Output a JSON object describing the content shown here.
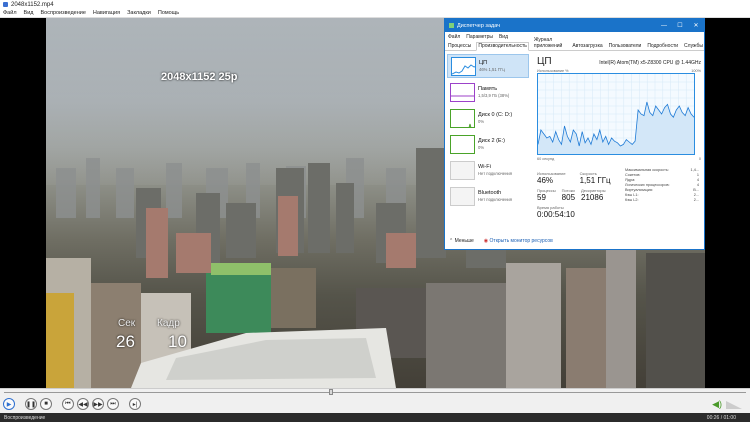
{
  "window": {
    "title": "2048x1152.mp4"
  },
  "menu": [
    "Файл",
    "Вид",
    "Воспроизведение",
    "Навигация",
    "Закладки",
    "Помощь"
  ],
  "osd": {
    "resolution": "2048x1152 25p",
    "sec_label": "Сек",
    "sec_value": "26",
    "frame_label": "Кадр",
    "frame_value": "10"
  },
  "seek": {
    "progress_fraction": 0.44
  },
  "controls": [
    "play-icon",
    "pause-icon",
    "stop-icon",
    "prev-icon",
    "rewind-icon",
    "forward-icon",
    "next-icon",
    "frame-step-icon"
  ],
  "status": {
    "text": "Воспроизведение",
    "time": "00:26 / 01:00"
  },
  "taskmanager": {
    "title": "Диспетчер задач",
    "menu": [
      "Файл",
      "Параметры",
      "Вид"
    ],
    "tabs": [
      "Процессы",
      "Производительность",
      "Журнал приложений",
      "Автозагрузка",
      "Пользователи",
      "Подробности",
      "Службы"
    ],
    "active_tab": 1,
    "resources": [
      {
        "name": "ЦП",
        "sub": "46% 1,51 ГГц"
      },
      {
        "name": "Память",
        "sub": "1,5/3,9 ГБ (38%)"
      },
      {
        "name": "Диск 0 (C: D:)",
        "sub": "0%"
      },
      {
        "name": "Диск 2 (E:)",
        "sub": "0%"
      },
      {
        "name": "Wi-Fi",
        "sub": "Нет подключения"
      },
      {
        "name": "Bluetooth",
        "sub": "Нет подключения"
      }
    ],
    "cpu": {
      "heading": "ЦП",
      "model": "Intel(R) Atom(TM) x5-Z8300 CPU @ 1.44GHz",
      "chart_label": "Использование %",
      "chart_max": "100%",
      "chart_time": "60 секунд",
      "chart_min": "0",
      "utilization_label": "Использование",
      "utilization": "46%",
      "speed_label": "Скорость",
      "speed": "1,51 ГГц",
      "processes_label": "Процессы",
      "processes": "59",
      "threads_label": "Потоки",
      "threads": "805",
      "handles_label": "Дескрипторы",
      "handles": "21086",
      "uptime_label": "Время работы",
      "uptime": "0:00:54:10",
      "specs": [
        {
          "k": "Максимальная скорость:",
          "v": "1,4..."
        },
        {
          "k": "Сокетов:",
          "v": "1"
        },
        {
          "k": "Ядра:",
          "v": "4"
        },
        {
          "k": "Логических процессоров:",
          "v": "4"
        },
        {
          "k": "Виртуализация:",
          "v": "В..."
        },
        {
          "k": "Кэш L1:",
          "v": "2..."
        },
        {
          "k": "Кэш L2:",
          "v": "2..."
        }
      ]
    },
    "footer": {
      "less": "Меньше",
      "monitor": "Открыть монитор ресурсов"
    }
  },
  "chart_data": {
    "type": "area",
    "ylabel": "Использование %",
    "ylim": [
      0,
      100
    ],
    "values": [
      12,
      30,
      25,
      20,
      22,
      15,
      28,
      18,
      12,
      35,
      22,
      15,
      30,
      25,
      10,
      28,
      14,
      20,
      12,
      25,
      18,
      30,
      15,
      22,
      12,
      20,
      16,
      14,
      10,
      12,
      18,
      15,
      12,
      16,
      55,
      50,
      48,
      65,
      52,
      48,
      60,
      55,
      50,
      58,
      62,
      50,
      46,
      55,
      60,
      52,
      48,
      58,
      50,
      46
    ]
  }
}
